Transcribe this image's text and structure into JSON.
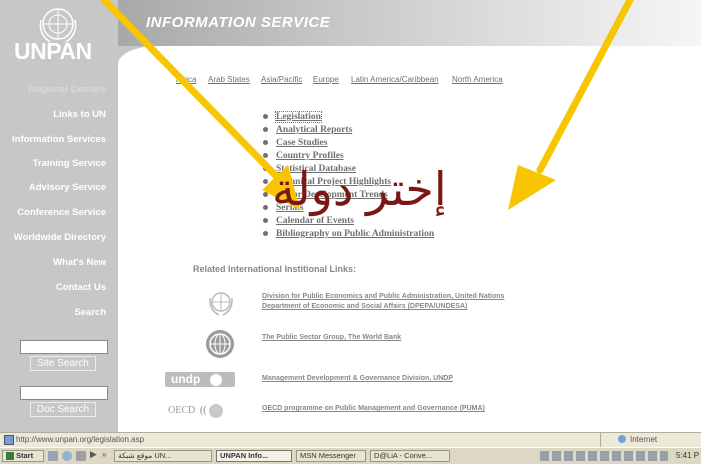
{
  "header": {
    "title": "INFORMATION SERVICE",
    "logo_text": "UNPAN"
  },
  "sidebar": {
    "items": [
      "Regional Centers",
      "Links to UN",
      "Information Services",
      "Training Service",
      "Advisory Service",
      "Conference Service",
      "Worldwide Directory",
      "What's New",
      "Contact Us",
      "Search"
    ],
    "site_search_button": "Site Search",
    "doc_search_button": "Doc Search"
  },
  "regions": [
    "Africa",
    "Arab States",
    "Asia/Pacific",
    "Europe",
    "Latin America/Caribbean",
    "North America"
  ],
  "services": [
    "Legislation",
    "Analytical Reports",
    "Case Studies",
    "Country Profiles",
    "Statistical Database",
    "Technical Project Highlights",
    "Major Development Trends",
    "Serials",
    "Calendar of Events",
    "Bibliography on Public Administration"
  ],
  "related": {
    "title": "Related International Institional Links:",
    "links": [
      {
        "line1": "Division for Public Economics and Public Administration, United Nations",
        "line2": "Department of Economic and Social Affairs (DPEPA/UNDESA)",
        "logo": "un-emblem-icon"
      },
      {
        "line1": "The Public Sector Group, The World Bank",
        "line2": "",
        "logo": "world-bank-icon"
      },
      {
        "line1": "Management Development & Governance Division, UNDP",
        "line2": "",
        "logo": "undp-logo"
      },
      {
        "line1": "OECD programme on Public Management and Governance (PUMA)",
        "line2": "",
        "logo": "oecd-logo"
      }
    ],
    "logo_texts": {
      "undp": "undp",
      "oecd": "OECD"
    }
  },
  "overlay": {
    "arabic_text": "إختر دولة",
    "arrow_color": "#f7c600"
  },
  "statusbar": {
    "url": "http://www.unpan.org/legislation.asp",
    "zone": "Internet"
  },
  "taskbar": {
    "start": "Start",
    "tasks": [
      "موقع شبكة UN...",
      "UNPAN Info...",
      "MSN Messenger",
      "D@LiA - Conve..."
    ],
    "clock": "5:41 P"
  },
  "colors": {
    "sidebar_bg": "#c7c7c7",
    "link_gray": "#707070",
    "arabic": "#7a1714"
  }
}
